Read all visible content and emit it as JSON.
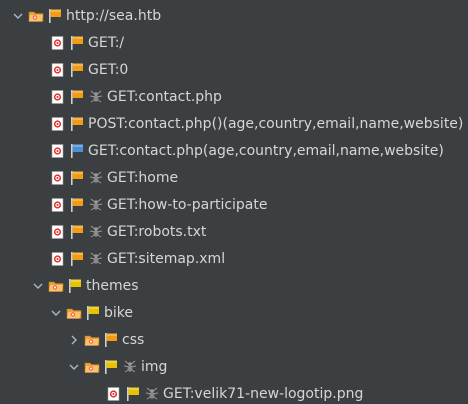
{
  "tree": {
    "root": {
      "label": "http://sea.htb",
      "expanded": true,
      "flag_color": "#f39c12"
    },
    "root_children": [
      {
        "label": "GET:/",
        "flag_color": "#f39c12",
        "has_spider": false
      },
      {
        "label": "GET:0",
        "flag_color": "#f39c12",
        "has_spider": false
      },
      {
        "label": "GET:contact.php",
        "flag_color": "#f39c12",
        "has_spider": true
      },
      {
        "label": "POST:contact.php()(age,country,email,name,website)",
        "flag_color": "#f39c12",
        "has_spider": false
      },
      {
        "label": "GET:contact.php(age,country,email,name,website)",
        "flag_color": "#4a90d9",
        "has_spider": false
      },
      {
        "label": "GET:home",
        "flag_color": "#f39c12",
        "has_spider": true
      },
      {
        "label": "GET:how-to-participate",
        "flag_color": "#f39c12",
        "has_spider": true
      },
      {
        "label": "GET:robots.txt",
        "flag_color": "#f39c12",
        "has_spider": true
      },
      {
        "label": "GET:sitemap.xml",
        "flag_color": "#f39c12",
        "has_spider": true
      }
    ],
    "themes": {
      "label": "themes",
      "expanded": true,
      "flag_color": "#e6c200"
    },
    "bike": {
      "label": "bike",
      "expanded": true,
      "flag_color": "#e6c200"
    },
    "css": {
      "label": "css",
      "expanded": false,
      "flag_color": "#f39c12"
    },
    "img": {
      "label": "img",
      "expanded": true,
      "flag_color": "#e6c200"
    },
    "img_children": [
      {
        "label": "GET:velik71-new-logotip.png",
        "flag_color": "#e6c200",
        "has_spider": true
      }
    ]
  },
  "icons": {
    "expand": "chevron-down-icon",
    "collapse": "chevron-right-icon",
    "folder": "folder-open-icon",
    "request": "request-target-icon",
    "flag": "flag-icon",
    "spider": "spider-icon"
  }
}
